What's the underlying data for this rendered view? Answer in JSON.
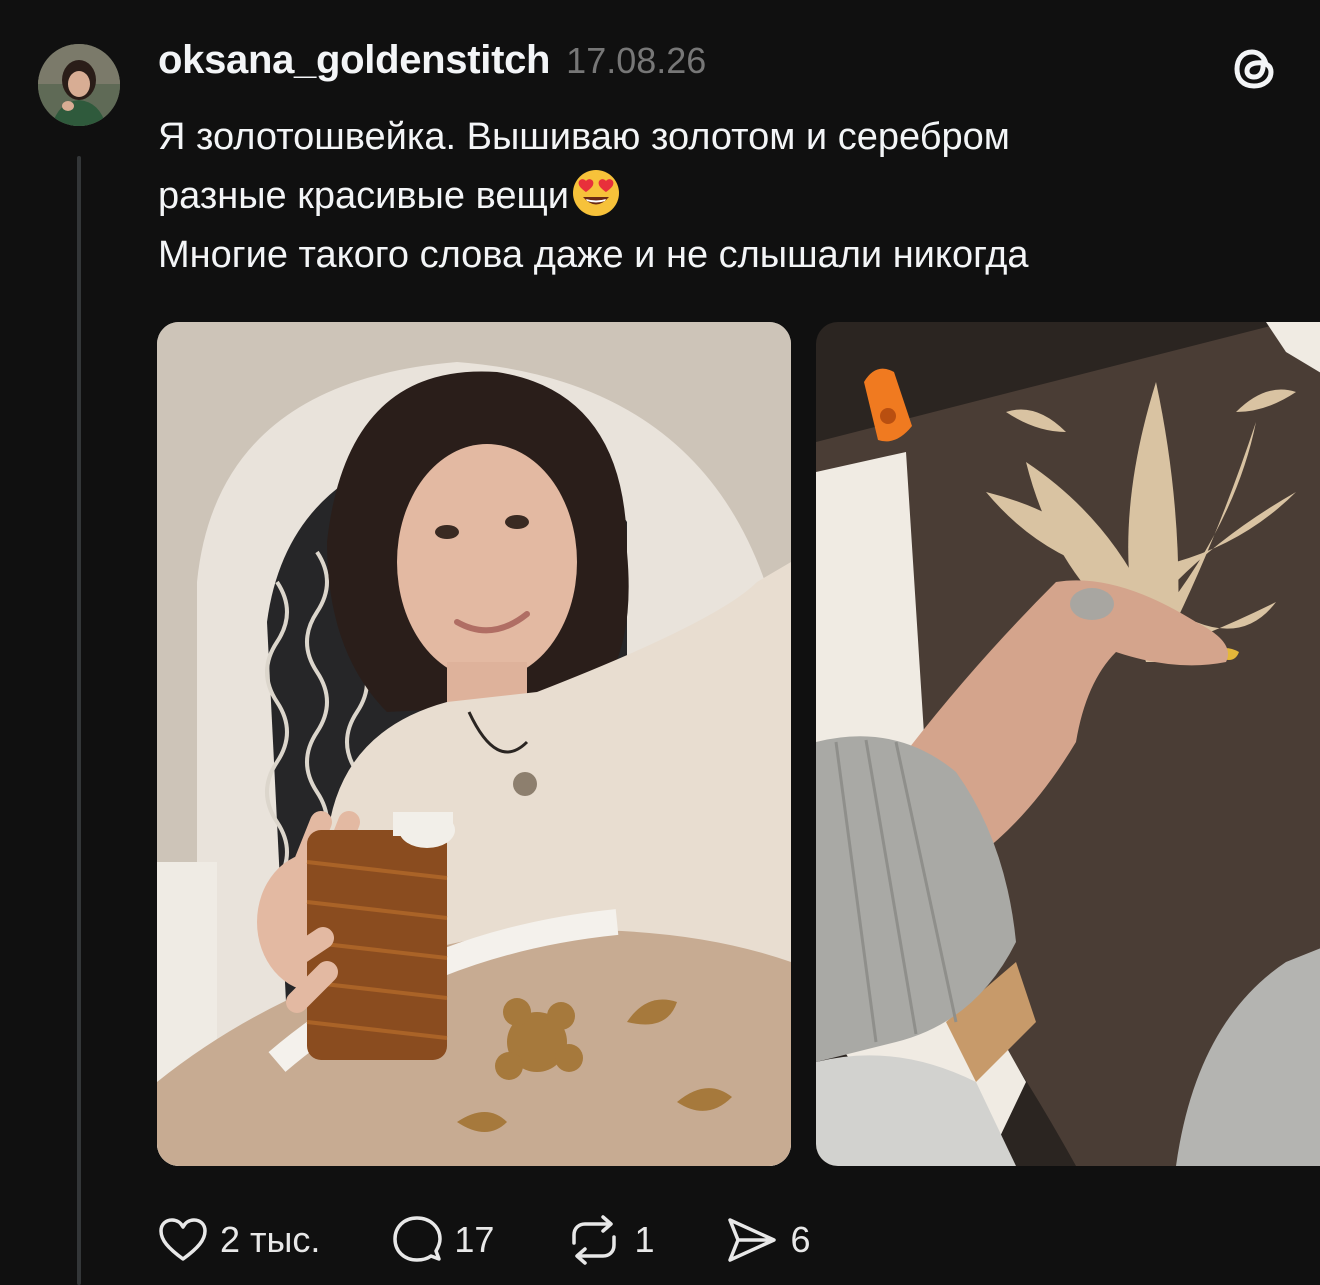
{
  "post": {
    "username": "oksana_goldenstitch",
    "timestamp": "17.08.26",
    "text_lines": [
      "Я золотошвейка. Вышиваю золотом и серебром",
      "разные красивые вещи",
      "Многие такого слова даже и не слышали никогда"
    ],
    "emoji": "heart-eyes-emoji",
    "brand_icon": "threads-logo-icon"
  },
  "media": [
    {
      "icon": "photo-woman-holding-gold-thread-spool"
    },
    {
      "icon": "photo-hand-embroidering-gold-leaf-pattern"
    }
  ],
  "actions": {
    "like": {
      "icon": "heart-icon",
      "count": "2 тыс."
    },
    "reply": {
      "icon": "speech-bubble-icon",
      "count": "17"
    },
    "repost": {
      "icon": "repost-icon",
      "count": "1"
    },
    "share": {
      "icon": "paper-plane-icon",
      "count": "6"
    }
  },
  "colors": {
    "background": "#101010",
    "text": "#f3f5f7",
    "muted": "#777777",
    "thread_line": "#333638"
  }
}
